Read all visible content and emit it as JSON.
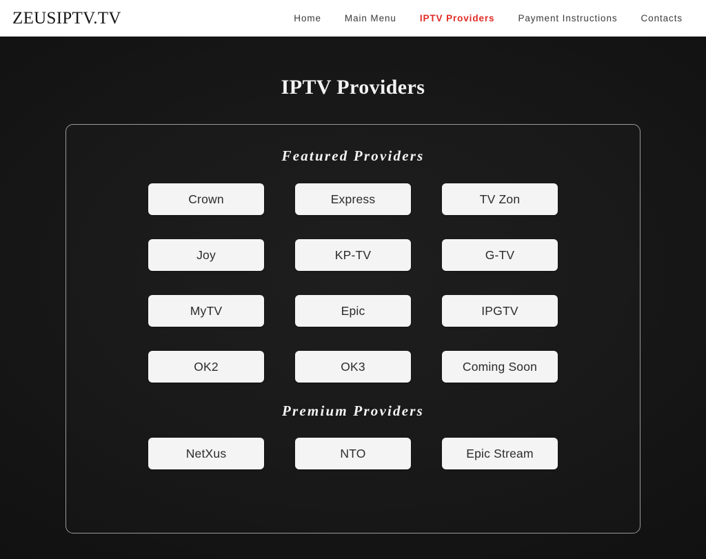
{
  "header": {
    "brand": "ZEUSIPTV.TV",
    "nav": [
      {
        "label": "Home",
        "active": false
      },
      {
        "label": "Main Menu",
        "active": false
      },
      {
        "label": "IPTV Providers",
        "active": true
      },
      {
        "label": "Payment Instructions",
        "active": false
      },
      {
        "label": "Contacts",
        "active": false
      }
    ],
    "active_color": "#e02b26",
    "background": "#ffffff"
  },
  "main": {
    "page_title": "IPTV Providers",
    "background": "#141414",
    "panel": {
      "border_color": "#9a9a9a",
      "sections": [
        {
          "heading": "Featured Providers",
          "providers": [
            "Crown",
            "Express",
            "TV Zon",
            "Joy",
            "KP-TV",
            "G-TV",
            "MyTV",
            "Epic",
            "IPGTV",
            "OK2",
            "OK3",
            "Coming Soon"
          ]
        },
        {
          "heading": "Premium Providers",
          "providers": [
            "NetXus",
            "NTO",
            "Epic Stream"
          ]
        }
      ],
      "button_color": "#f4f4f4",
      "button_text_color": "#2b2b2b"
    }
  }
}
